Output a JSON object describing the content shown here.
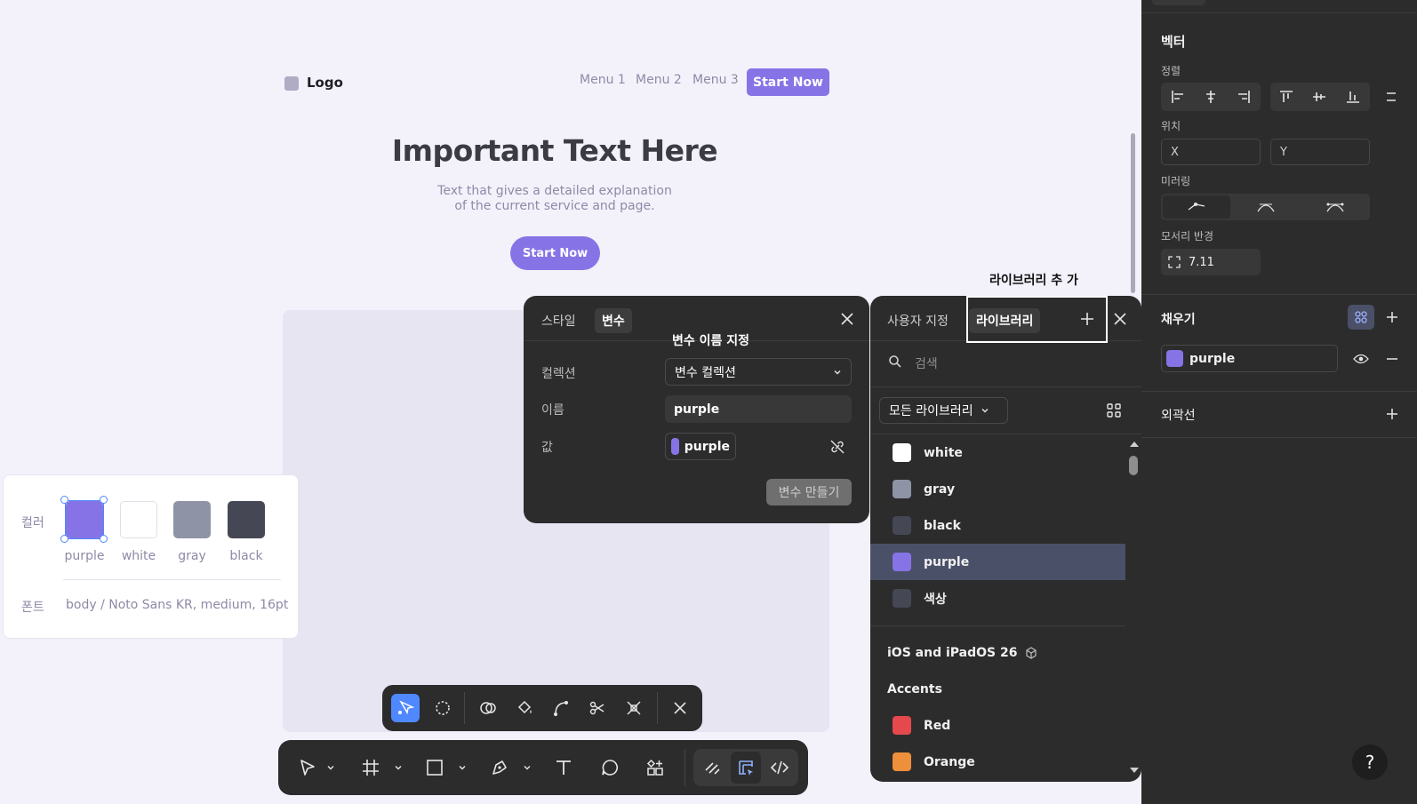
{
  "site": {
    "logo": "Logo",
    "menu": [
      "Menu 1",
      "Menu 2",
      "Menu 3"
    ],
    "nav_cta": "Start Now",
    "hero_title": "Important Text Here",
    "hero_sub_1": "Text that gives a detailed explanation",
    "hero_sub_2": "of the current service and page.",
    "hero_cta": "Start Now"
  },
  "style_card": {
    "color_label": "컬러",
    "swatches": [
      {
        "name": "purple",
        "color": "#8674e6"
      },
      {
        "name": "white",
        "color": "#ffffff"
      },
      {
        "name": "gray",
        "color": "#8f93a6"
      },
      {
        "name": "black",
        "color": "#454754"
      }
    ],
    "font_label": "폰트",
    "font_value": "body / Noto Sans KR, medium, 16pt"
  },
  "variable_panel": {
    "tab_style": "스타일",
    "tab_variable": "변수",
    "collection_label": "컬렉션",
    "collection_value": "변수 컬렉션",
    "name_label": "이름",
    "name_value": "purple",
    "value_label": "값",
    "value_text": "purple",
    "create_button": "변수 만들기"
  },
  "library_panel": {
    "tab_custom": "사용자 지정",
    "tab_library": "라이브러리",
    "search_placeholder": "검색",
    "filter": "모든 라이브러리",
    "items": [
      {
        "name": "white",
        "color": "#ffffff"
      },
      {
        "name": "gray",
        "color": "#8f93a6"
      },
      {
        "name": "black",
        "color": "#454754"
      },
      {
        "name": "purple",
        "color": "#8674e6"
      },
      {
        "name": "색상",
        "color": "#454754"
      }
    ],
    "group_title": "iOS and iPadOS 26",
    "subgroup_title": "Accents",
    "accent_items": [
      {
        "name": "Red",
        "color": "#e5484d"
      },
      {
        "name": "Orange",
        "color": "#ee8f3c"
      }
    ]
  },
  "annotations": {
    "name_hint": "변수 이름 지정",
    "add_library": "라이브러리 추 가"
  },
  "properties": {
    "section_vector": "벡터",
    "align_label": "정렬",
    "position_label": "위치",
    "x_placeholder": "X",
    "y_placeholder": "Y",
    "mirroring_label": "미러링",
    "corner_label": "모서리 반경",
    "corner_value": "7.11",
    "fill_label": "채우기",
    "fill_value": "purple",
    "fill_color": "#8674e6",
    "stroke_label": "외곽선"
  },
  "help": "?"
}
